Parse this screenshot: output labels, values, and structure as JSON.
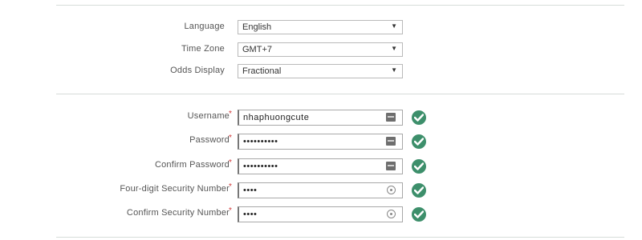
{
  "preferences": {
    "language": {
      "label": "Language",
      "value": "English"
    },
    "time_zone": {
      "label": "Time Zone",
      "value": "GMT+7"
    },
    "odds_display": {
      "label": "Odds Display",
      "value": "Fractional"
    }
  },
  "account": {
    "required_marker": "*",
    "username": {
      "label": "Username",
      "value": "nhaphuongcute",
      "valid": true
    },
    "password": {
      "label": "Password",
      "value": "••••••••••",
      "valid": true
    },
    "confirm_password": {
      "label": "Confirm Password",
      "value": "••••••••••",
      "valid": true
    },
    "security_number": {
      "label": "Four-digit Security Number",
      "value": "••••",
      "valid": true
    },
    "confirm_security_number": {
      "label": "Confirm Security Number",
      "value": "••••",
      "valid": true
    }
  },
  "icons": {
    "dropdown": "chevron-down-icon",
    "keyboard": "keyboard-icon",
    "reveal": "eye-icon",
    "valid": "check-circle-icon"
  },
  "colors": {
    "valid_green": "#3d8f6b",
    "required_red": "#d23a3a",
    "divider": "#d6dcd9"
  }
}
